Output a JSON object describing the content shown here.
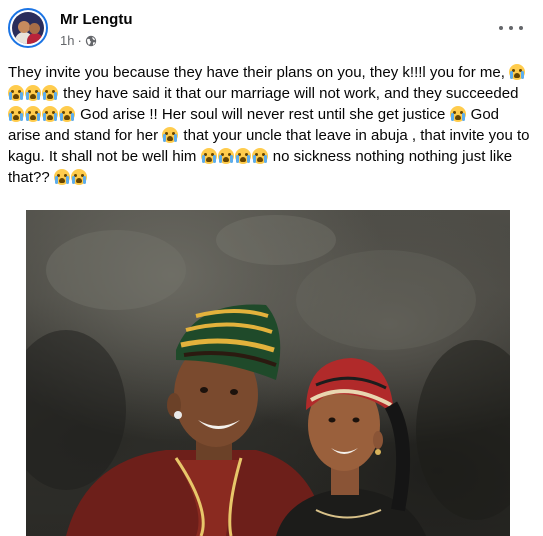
{
  "post": {
    "author": "Mr Lengtu",
    "time": "1h",
    "separator": "·",
    "privacy_icon": "globe-icon",
    "more_icon": "more-options-icon",
    "text_segments": [
      {
        "t": "They invite you because they have their plans on you, they k!!!l you for me, "
      },
      {
        "e": 4
      },
      {
        "t": " they have  said it that our marriage will not work, and they succeeded "
      },
      {
        "e": 4
      },
      {
        "t": " God arise !! Her soul will never rest until she get  justice "
      },
      {
        "e": 1
      },
      {
        "t": " God arise and stand for her "
      },
      {
        "e": 1
      },
      {
        "t": " that your uncle that leave in abuja , that invite you to kagu. It shall not be well him "
      },
      {
        "e": 4
      },
      {
        "t": " no sickness nothing nothing just like that?? "
      },
      {
        "e": 2
      }
    ],
    "emoji_icon": "loudly-crying-face-icon",
    "photo_icon": "couple-portrait-photo"
  },
  "colors": {
    "link_blue": "#1b74e4",
    "secondary_text": "#65676b",
    "primary_text": "#050505"
  }
}
